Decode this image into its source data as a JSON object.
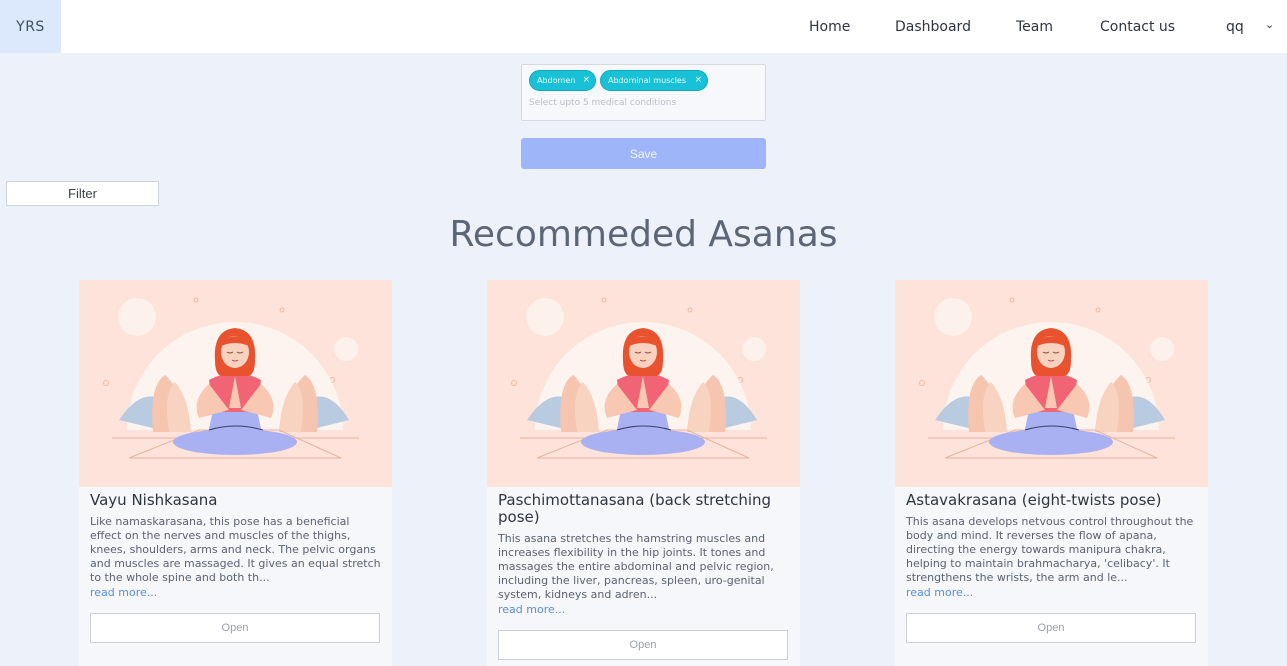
{
  "navbar": {
    "brand": "YRS",
    "links": [
      "Home",
      "Dashboard",
      "Team",
      "Contact us"
    ],
    "user": "qq"
  },
  "conditions": {
    "chips": [
      "Abdomen",
      "Abdominal muscles"
    ],
    "placeholder": "Select upto 5 medical conditions"
  },
  "save_label": "Save",
  "filter_label": "Filter",
  "section_title": "Recommeded Asanas",
  "colors": {
    "chip": "#19c1d6",
    "save": "#9fb5f9",
    "link": "#5b8ddc",
    "card_image_bg": "#fde3da"
  },
  "cards": [
    {
      "title": "Vayu Nishkasana",
      "description": "Like namaskarasana, this pose has a beneficial effect on the nerves and muscles of the thighs, knees, shoulders, arms and neck. The pelvic organs and muscles are massaged. It gives an equal stretch to the whole spine and both th...",
      "read_more": "read more...",
      "open_label": "Open"
    },
    {
      "title": "Paschimottanasana (back stretching pose)",
      "description": "This asana stretches the hamstring muscles and increases flexibility in the hip joints. It tones and massages the entire abdominal and pelvic region, including the liver, pancreas, spleen, uro-genital system, kidneys and adren...",
      "read_more": "read more...",
      "open_label": "Open"
    },
    {
      "title": "Astavakrasana (eight-twists pose)",
      "description": "This asana develops netvous control throughout the body and mind. It reverses the flow of apana, directing the energy towards manipura chakra, helping to maintain brahmacharya, 'celibacy'. It strengthens the wrists, the arm and le...",
      "read_more": "read more...",
      "open_label": "Open"
    }
  ]
}
